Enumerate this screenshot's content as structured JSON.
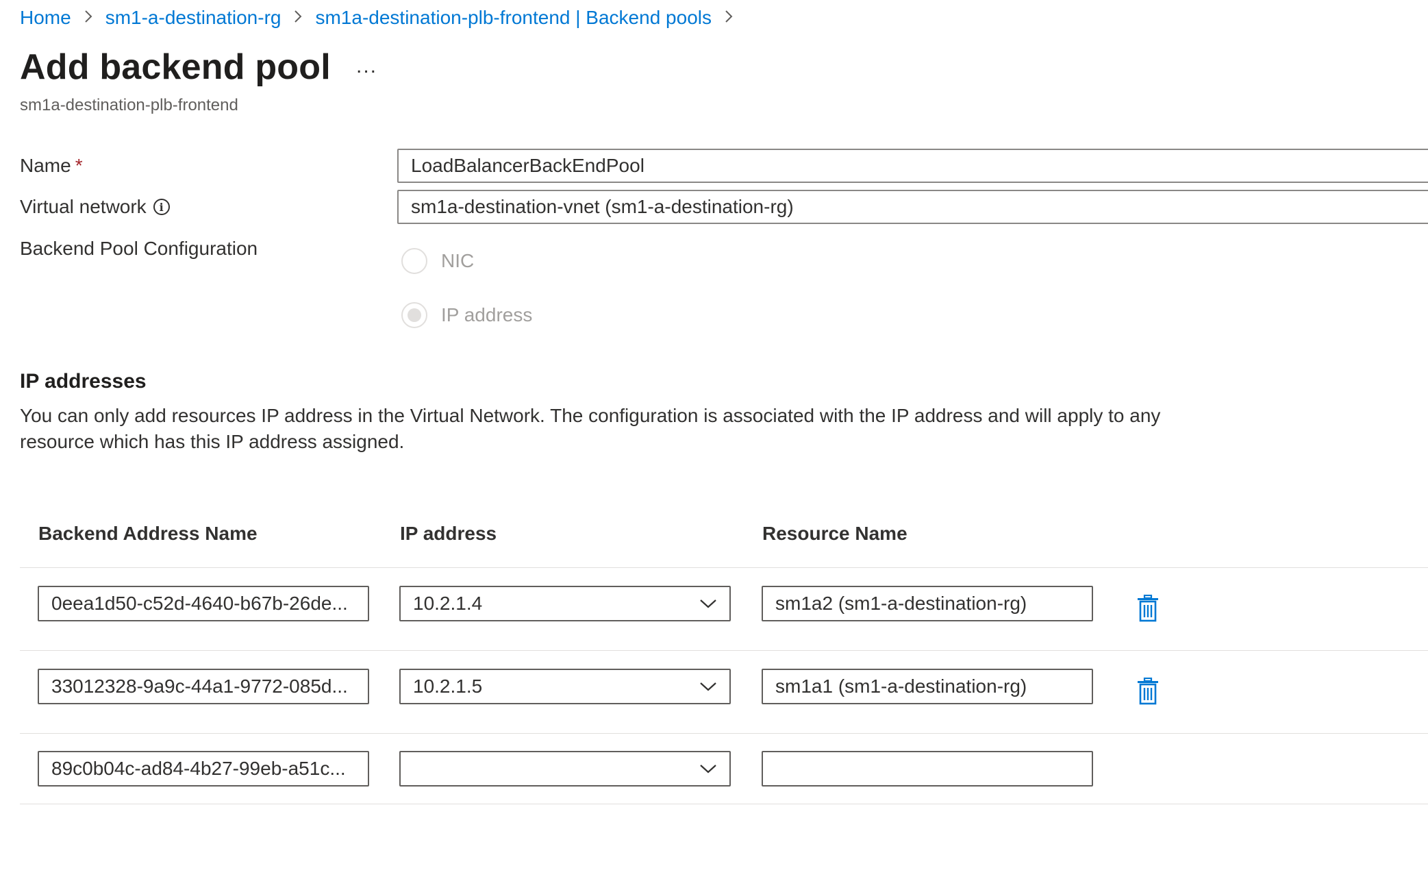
{
  "breadcrumb": {
    "items": [
      "Home",
      "sm1-a-destination-rg",
      "sm1a-destination-plb-frontend | Backend pools"
    ],
    "separator": ">"
  },
  "header": {
    "title": "Add backend pool",
    "more_label": "...",
    "subtitle": "sm1a-destination-plb-frontend"
  },
  "form": {
    "name_label": "Name",
    "required_mark": "*",
    "name_value": "LoadBalancerBackEndPool",
    "vnet_label": "Virtual network",
    "info_glyph": "i",
    "vnet_value": "sm1a-destination-vnet (sm1-a-destination-rg)",
    "config_label": "Backend Pool Configuration",
    "config_options": [
      {
        "label": "NIC",
        "selected": false,
        "disabled": true
      },
      {
        "label": "IP address",
        "selected": true,
        "disabled": true
      }
    ]
  },
  "ip_section": {
    "title": "IP addresses",
    "description": "You can only add resources IP address in the Virtual Network. The configuration is associated with the IP address and will apply to any resource which has this IP address assigned."
  },
  "table": {
    "headers": [
      "Backend Address Name",
      "IP address",
      "Resource Name"
    ],
    "rows": [
      {
        "name": "0eea1d50-c52d-4640-b67b-26de...",
        "ip": "10.2.1.4",
        "resource": "sm1a2 (sm1-a-destination-rg)",
        "deletable": true
      },
      {
        "name": "33012328-9a9c-44a1-9772-085d...",
        "ip": "10.2.1.5",
        "resource": "sm1a1 (sm1-a-destination-rg)",
        "deletable": true
      },
      {
        "name": "89c0b04c-ad84-4b27-99eb-a51c...",
        "ip": "",
        "resource": "",
        "deletable": false
      }
    ]
  },
  "icons": {
    "more": "ellipsis-icon",
    "info": "info-icon",
    "chevron": "chevron-down-icon",
    "delete": "trash-icon",
    "breadcrumb_sep": "chevron-right-icon"
  },
  "colors": {
    "link": "#0078d4",
    "text": "#323130",
    "required": "#a4262c",
    "border": "#8a8886",
    "disabled": "#a19f9d",
    "divider": "#e1dfdd"
  }
}
